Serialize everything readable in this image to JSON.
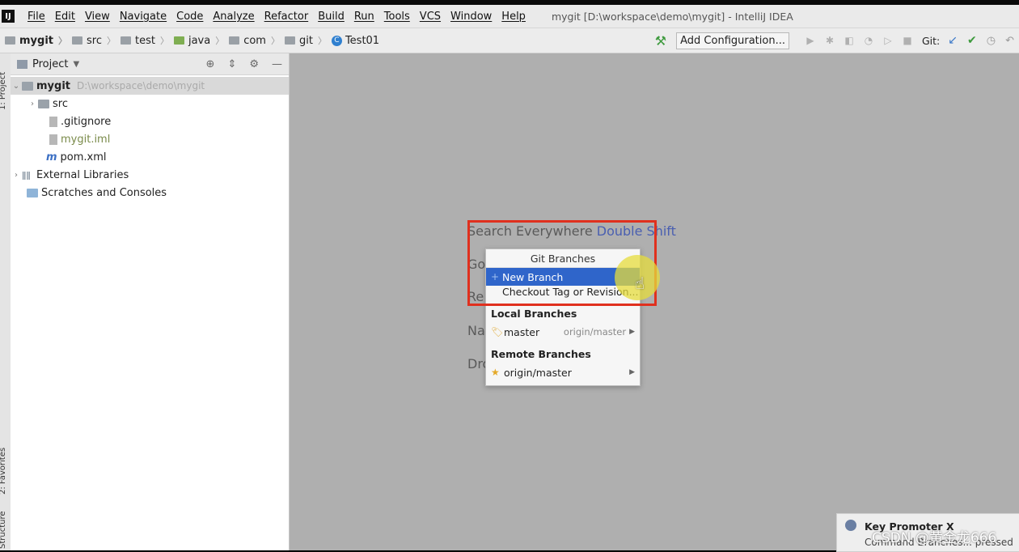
{
  "menubar": {
    "items": [
      "File",
      "Edit",
      "View",
      "Navigate",
      "Code",
      "Analyze",
      "Refactor",
      "Build",
      "Run",
      "Tools",
      "VCS",
      "Window",
      "Help"
    ],
    "window_title": "mygit [D:\\workspace\\demo\\mygit] - IntelliJ IDEA"
  },
  "navbar": {
    "breadcrumbs": [
      "mygit",
      "src",
      "test",
      "java",
      "com",
      "git",
      "Test01"
    ],
    "add_configuration": "Add Configuration...",
    "git_label": "Git:"
  },
  "side_strip": {
    "project_tab": "1: Project",
    "favorites_tab": "2: Favorites",
    "structure_tab": "Structure"
  },
  "project_panel": {
    "title": "Project",
    "tree": {
      "root_name": "mygit",
      "root_path": "D:\\workspace\\demo\\mygit",
      "src": "src",
      "gitignore": ".gitignore",
      "iml": "mygit.iml",
      "pom": "pom.xml",
      "external_libraries": "External Libraries",
      "scratches": "Scratches and Consoles"
    }
  },
  "editor_hints": {
    "search_text": "Search Everywhere",
    "search_key": "Double Shift",
    "goto_partial": "Go",
    "recent_partial": "Re",
    "nav_partial": "Na",
    "drop_partial": "Dro"
  },
  "git_branches_popup": {
    "title": "Git Branches",
    "new_branch": "New Branch",
    "checkout": "Checkout Tag or Revision...",
    "local_header": "Local Branches",
    "local": [
      {
        "name": "master",
        "tracking": "origin/master"
      }
    ],
    "remote_header": "Remote Branches",
    "remote": [
      {
        "name": "origin/master"
      }
    ]
  },
  "key_promoter": {
    "title": "Key Promoter X",
    "text": "Command Branches... pressed"
  },
  "watermark": "CSDN @黄金龙666",
  "colors": {
    "selection_blue": "#2f65ca",
    "highlight_red": "#e0301e",
    "editor_bg": "#afafaf"
  }
}
